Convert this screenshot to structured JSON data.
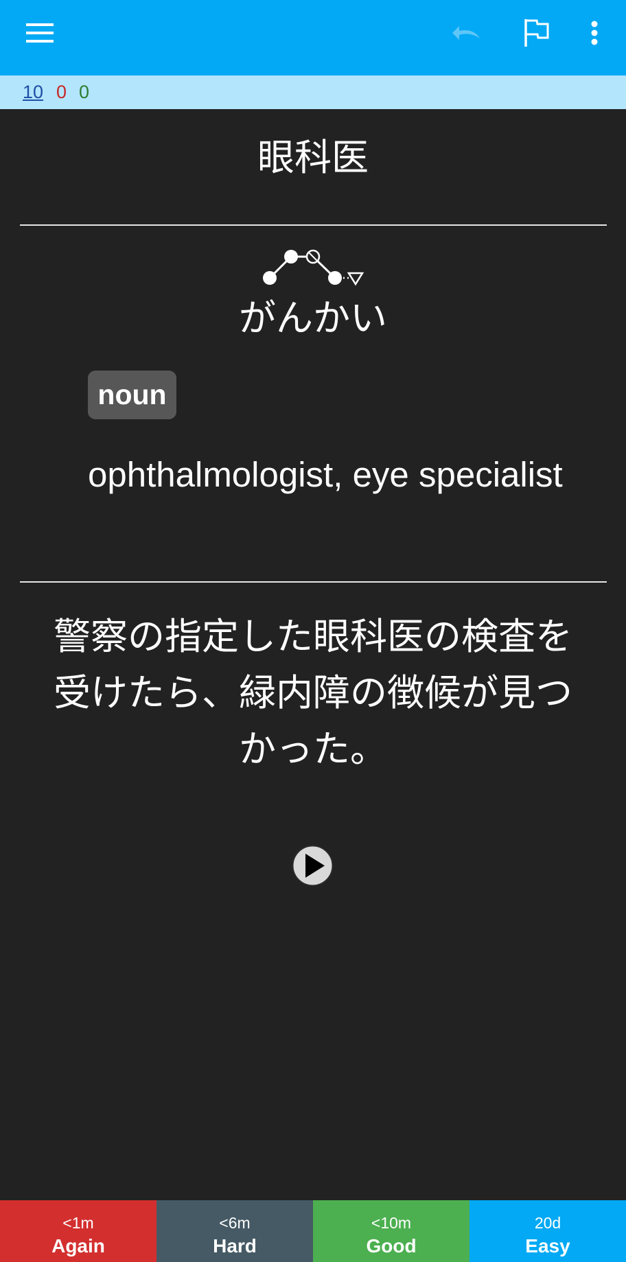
{
  "toolbar": {
    "menu_icon": "hamburger-menu-icon",
    "undo_icon": "undo-icon",
    "flag_icon": "flag-icon",
    "more_icon": "more-vert-icon"
  },
  "counts": {
    "new": "10",
    "learning": "0",
    "review": "0",
    "colors": {
      "new": "#1f4fa5",
      "learning": "#c62828",
      "review": "#2e7d32"
    }
  },
  "card": {
    "expression": "眼科医",
    "pitch_accent_icon": "pitch-accent-graph-icon",
    "reading": "がんかい",
    "part_of_speech": "noun",
    "meaning": "ophthalmologist, eye specialist",
    "sentence": "警察の指定した眼科医の検査を受けたら、緑内障の徴候が見つかった。",
    "audio_icon": "play-audio-icon"
  },
  "answers": [
    {
      "interval": "<1m",
      "label": "Again",
      "color": "#d32f2f"
    },
    {
      "interval": "<6m",
      "label": "Hard",
      "color": "#455a64"
    },
    {
      "interval": "<10m",
      "label": "Good",
      "color": "#4caf50"
    },
    {
      "interval": "20d",
      "label": "Easy",
      "color": "#03a9f4"
    }
  ],
  "theme": {
    "accent": "#03a9f4",
    "background": "#222222",
    "counts_bar": "#b3e5fc"
  }
}
